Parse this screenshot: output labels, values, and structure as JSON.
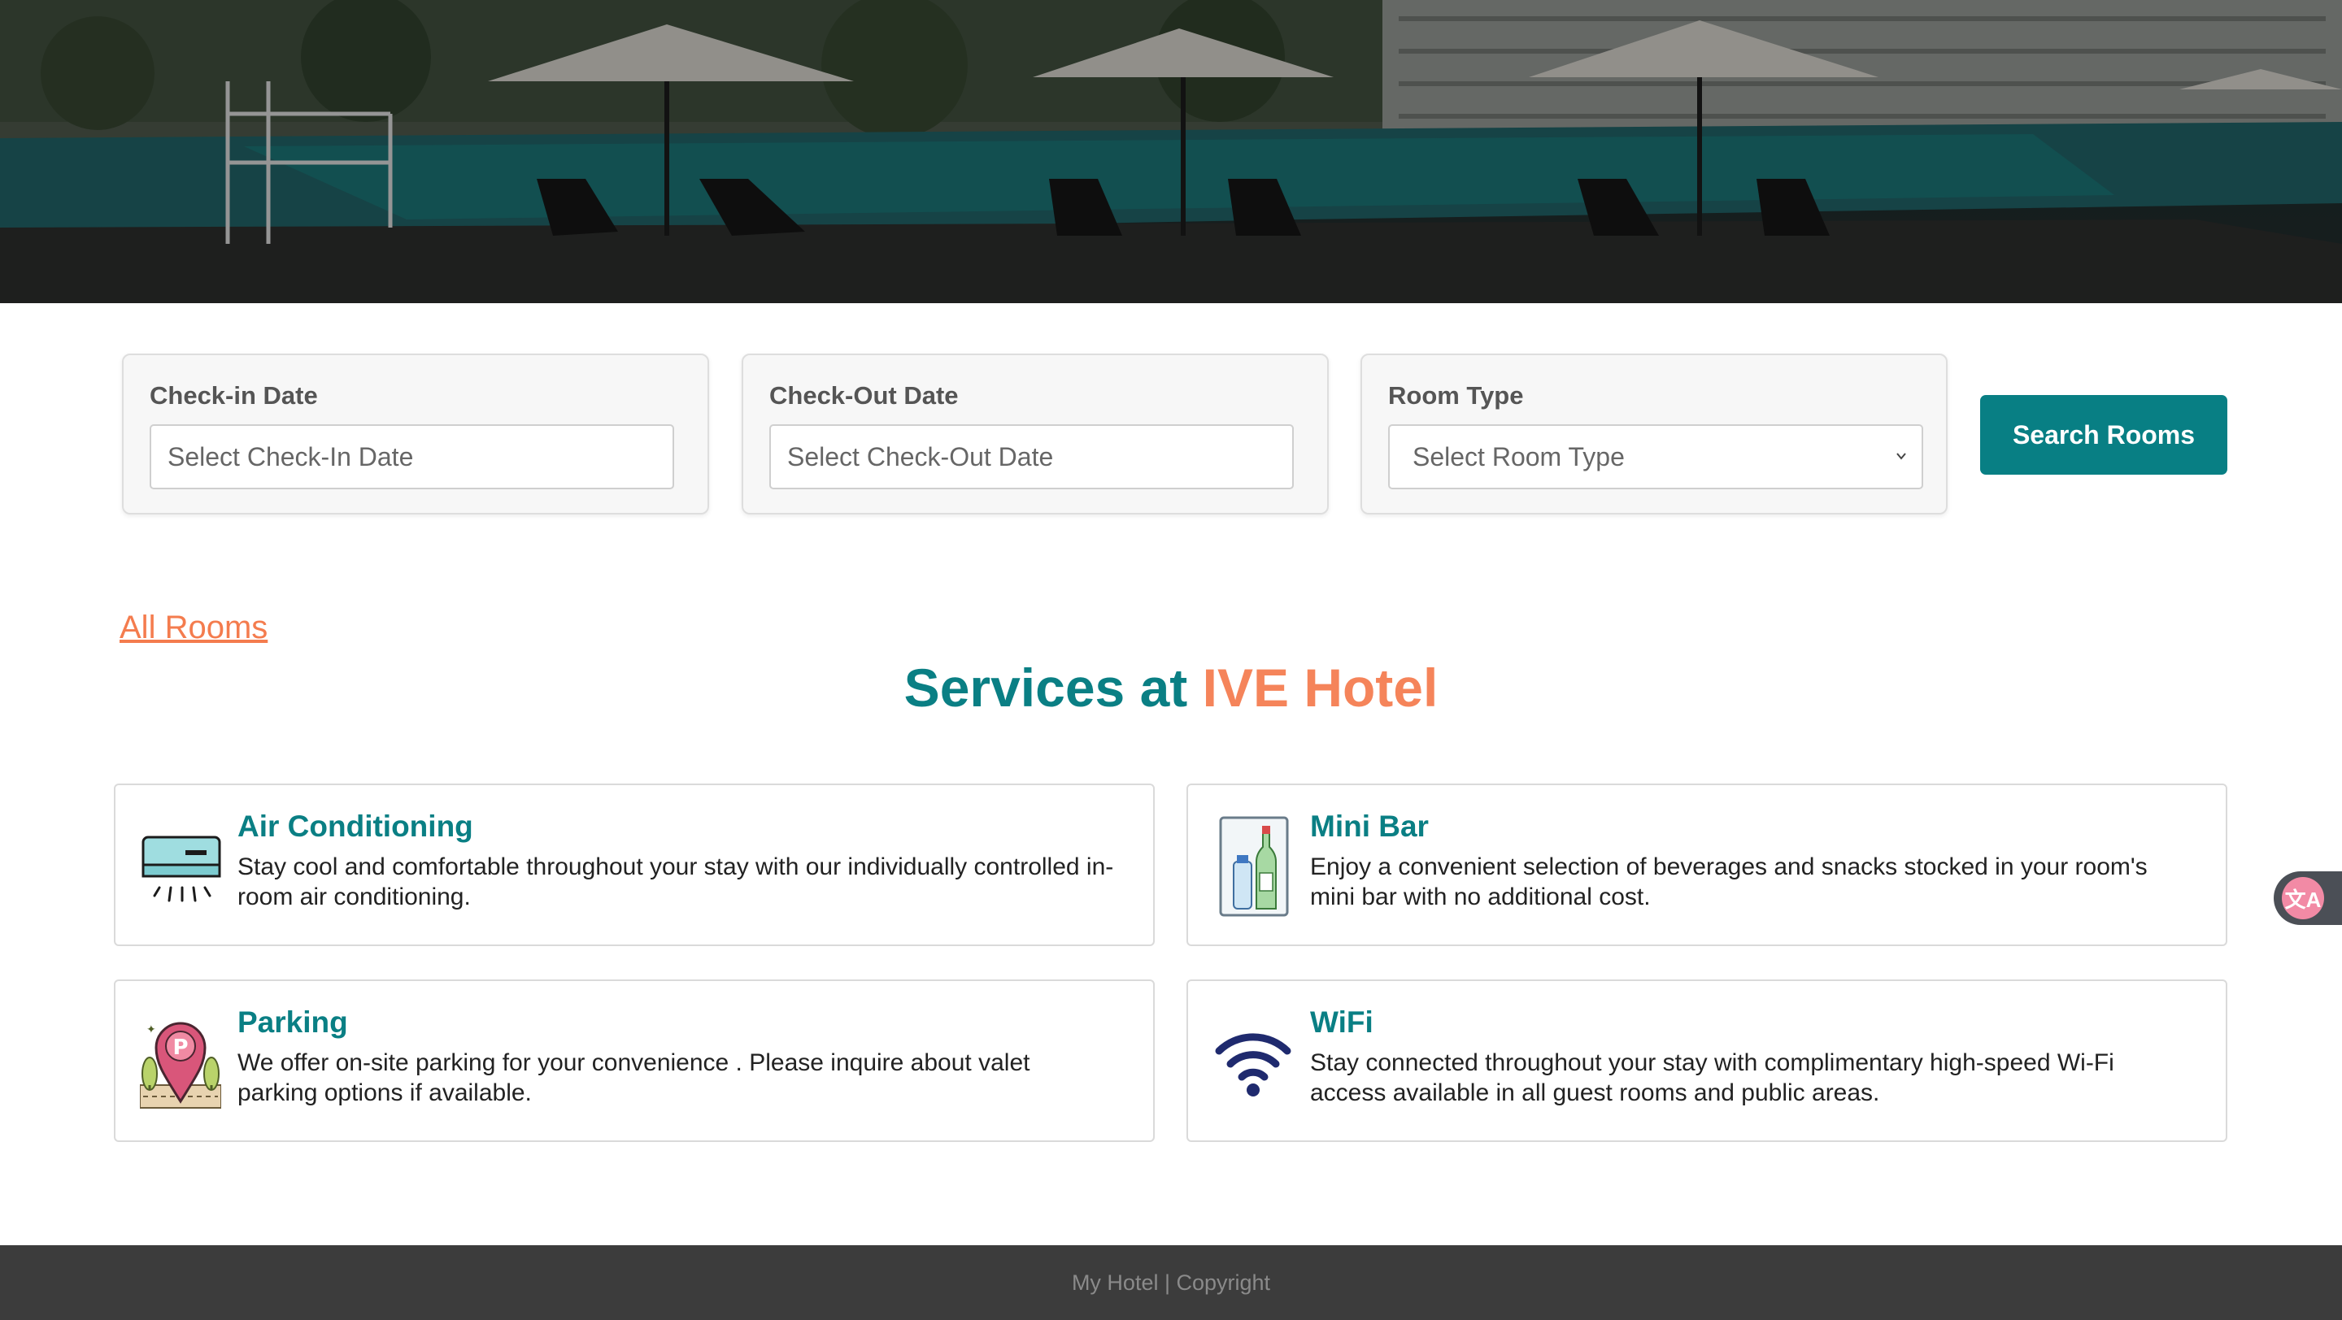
{
  "search": {
    "checkin": {
      "label": "Check-in Date",
      "placeholder": "Select Check-In Date"
    },
    "checkout": {
      "label": "Check-Out Date",
      "placeholder": "Select Check-Out Date"
    },
    "room_type": {
      "label": "Room Type",
      "selected": "Select Room Type"
    },
    "button_label": "Search Rooms"
  },
  "links": {
    "all_rooms": "All Rooms"
  },
  "services": {
    "title_prefix": "Services at ",
    "title_brand": "IVE Hotel",
    "items": [
      {
        "icon": "air-conditioner-icon",
        "title": "Air Conditioning",
        "description": "Stay cool and comfortable throughout your stay with our individually controlled in-room air conditioning."
      },
      {
        "icon": "mini-bar-icon",
        "title": "Mini Bar",
        "description": "Enjoy a convenient selection of beverages and snacks stocked in your room's mini bar with no additional cost."
      },
      {
        "icon": "parking-icon",
        "title": "Parking",
        "description": "We offer on-site parking for your convenience . Please inquire about valet parking options if available."
      },
      {
        "icon": "wifi-icon",
        "title": "WiFi",
        "description": "Stay connected throughout your stay with complimentary high-speed Wi-Fi access available in all guest rooms and public areas."
      }
    ]
  },
  "footer": {
    "text": "My Hotel | Copyright"
  },
  "colors": {
    "brand_teal": "#087f84",
    "accent_orange": "#f47c4e",
    "footer_bg": "#3c3c3c",
    "translate_pink": "#f28aa5"
  }
}
